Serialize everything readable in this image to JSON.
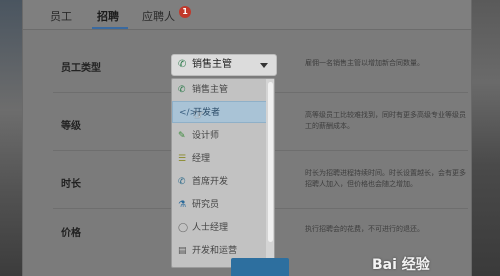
{
  "tabs": [
    {
      "label": "员工"
    },
    {
      "label": "招聘"
    },
    {
      "label": "应聘人"
    }
  ],
  "tab_badge": "1",
  "rows": {
    "type": {
      "label": "员工类型",
      "desc": "雇佣一名销售主管以增加新合同数量。"
    },
    "level": {
      "label": "等级",
      "desc": "高等级员工比较难找到，同时有更多高级专业等级员工的薪酬成本。"
    },
    "duration": {
      "label": "时长",
      "desc": "时长为招聘进程持续时间。时长设置越长，会有更多招聘人加入，但价格也会随之增加。"
    },
    "price": {
      "label": "价格",
      "desc": "执行招聘会的花费，不可进行的退还。"
    }
  },
  "select": {
    "value": "销售主管"
  },
  "dropdown_options": [
    {
      "label": "销售主管",
      "icon": "phone-icon"
    },
    {
      "label": "开发者",
      "icon": "code-icon"
    },
    {
      "label": "设计师",
      "icon": "brush-icon"
    },
    {
      "label": "经理",
      "icon": "list-icon"
    },
    {
      "label": "首席开发",
      "icon": "phone-icon"
    },
    {
      "label": "研究员",
      "icon": "flask-icon"
    },
    {
      "label": "人士经理",
      "icon": "circle-icon"
    },
    {
      "label": "开发和运营",
      "icon": "server-icon"
    }
  ],
  "watermark": "Bai 经验"
}
